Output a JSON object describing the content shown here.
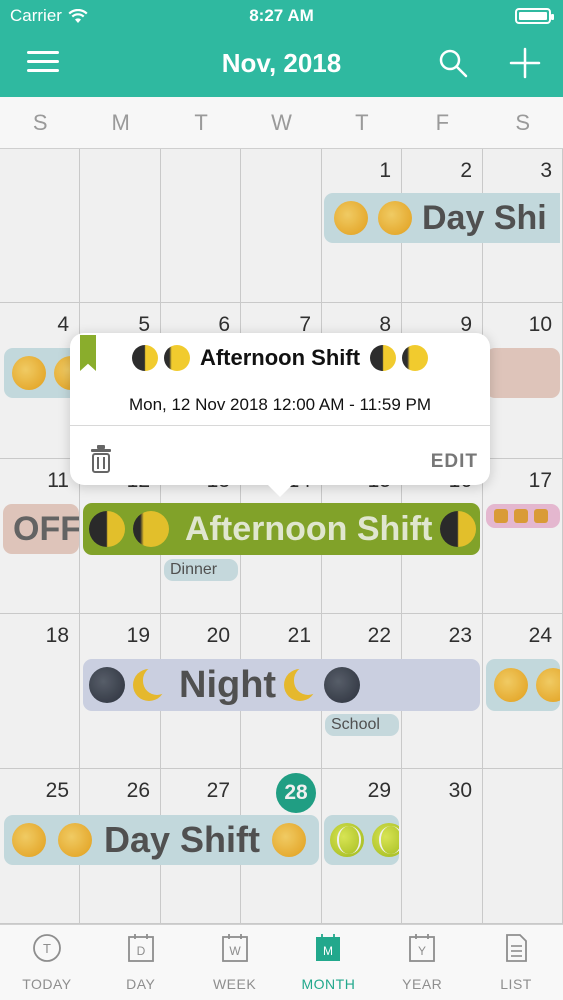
{
  "status_bar": {
    "carrier": "Carrier",
    "time": "8:27 AM"
  },
  "header": {
    "title": "Nov, 2018"
  },
  "weekdays": [
    "S",
    "M",
    "T",
    "W",
    "T",
    "F",
    "S"
  ],
  "weeks": [
    [
      "",
      "",
      "",
      "",
      "1",
      "2",
      "3"
    ],
    [
      "4",
      "5",
      "6",
      "7",
      "8",
      "9",
      "10"
    ],
    [
      "11",
      "12",
      "13",
      "14",
      "15",
      "16",
      "17"
    ],
    [
      "18",
      "19",
      "20",
      "21",
      "22",
      "23",
      "24"
    ],
    [
      "25",
      "26",
      "27",
      "28",
      "29",
      "30",
      ""
    ]
  ],
  "today": "28",
  "events": {
    "day_shift_1": "Day Shi",
    "off": "OFF",
    "afternoon": "Afternoon Shift",
    "dinner": "Dinner",
    "night": "Night",
    "school": "School",
    "day_shift_5": "Day Shift"
  },
  "popover": {
    "title": "Afternoon Shift",
    "date_range": "Mon, 12 Nov 2018 12:00 AM - 11:59 PM",
    "edit_label": "EDIT"
  },
  "tabs": [
    {
      "label": "TODAY",
      "letter": "T"
    },
    {
      "label": "DAY",
      "letter": "D"
    },
    {
      "label": "WEEK",
      "letter": "W"
    },
    {
      "label": "MONTH",
      "letter": "M"
    },
    {
      "label": "YEAR",
      "letter": "Y"
    },
    {
      "label": "LIST",
      "letter": ""
    }
  ],
  "colors": {
    "accent": "#2fb9a0",
    "today_circle": "#22a88c",
    "day_shift_bg": "#cfe6ea",
    "afternoon_bg": "#8aad2c",
    "night_bg": "#d7dcef",
    "off_bg": "#ecd1c6",
    "tag_bg": "#d2e6ea"
  }
}
